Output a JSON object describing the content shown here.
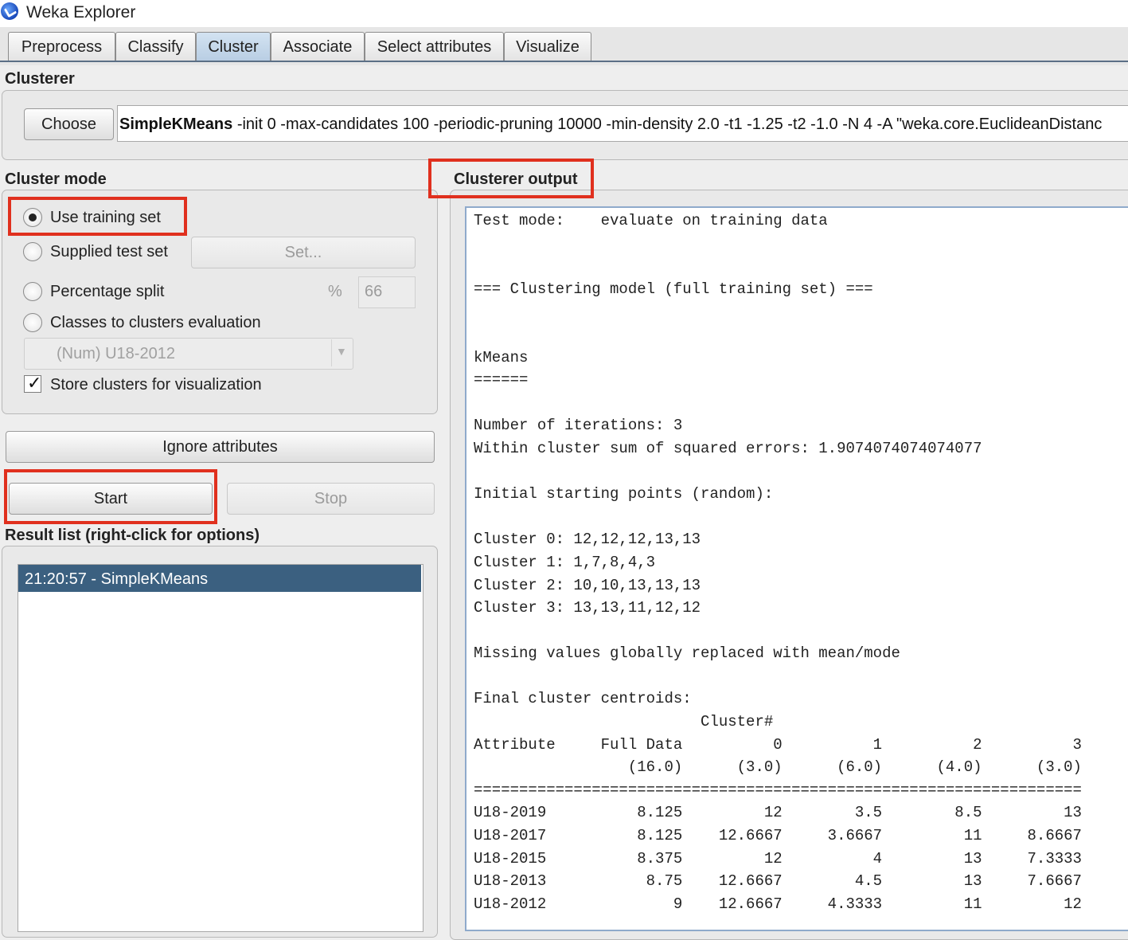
{
  "window": {
    "title": "Weka Explorer"
  },
  "tabs": [
    "Preprocess",
    "Classify",
    "Cluster",
    "Associate",
    "Select attributes",
    "Visualize"
  ],
  "active_tab": "Cluster",
  "clusterer": {
    "section_label": "Clusterer",
    "choose_label": "Choose",
    "algorithm": "SimpleKMeans",
    "options": " -init 0 -max-candidates 100 -periodic-pruning 10000 -min-density 2.0 -t1 -1.25 -t2 -1.0 -N 4 -A \"weka.core.EuclideanDistanc"
  },
  "cluster_mode": {
    "section_label": "Cluster mode",
    "options": [
      {
        "label": "Use training set",
        "checked": true
      },
      {
        "label": "Supplied test set",
        "checked": false
      },
      {
        "label": "Percentage split",
        "checked": false
      },
      {
        "label": "Classes to clusters evaluation",
        "checked": false
      }
    ],
    "set_button": "Set...",
    "percent_symbol": "%",
    "percent_value": "66",
    "class_select": "(Num) U18-2012",
    "store_clusters_label": "Store clusters for visualization",
    "store_clusters_checked": true
  },
  "buttons": {
    "ignore_attributes": "Ignore attributes",
    "start": "Start",
    "stop": "Stop"
  },
  "result_list": {
    "label": "Result list (right-click for options)",
    "items": [
      "21:20:57 - SimpleKMeans"
    ]
  },
  "output": {
    "label": "Clusterer output",
    "text": "Test mode:    evaluate on training data\n\n\n=== Clustering model (full training set) ===\n\n\nkMeans\n======\n\nNumber of iterations: 3\nWithin cluster sum of squared errors: 1.9074074074074077\n\nInitial starting points (random):\n\nCluster 0: 12,12,12,13,13\nCluster 1: 1,7,8,4,3\nCluster 2: 10,10,13,13,13\nCluster 3: 13,13,11,12,12\n\nMissing values globally replaced with mean/mode\n\nFinal cluster centroids:\n                         Cluster#\nAttribute     Full Data          0          1          2          3\n                 (16.0)      (3.0)      (6.0)      (4.0)      (3.0)\n===================================================================\nU18-2019          8.125         12        3.5        8.5         13\nU18-2017          8.125    12.6667     3.6667         11     8.6667\nU18-2015          8.375         12          4         13     7.3333\nU18-2013           8.75    12.6667        4.5         13     7.6667\nU18-2012              9    12.6667     4.3333         11         12"
  },
  "colors": {
    "highlight": "#e0301e",
    "selection": "#3b6080",
    "active_tab": "#c4d6ea"
  }
}
